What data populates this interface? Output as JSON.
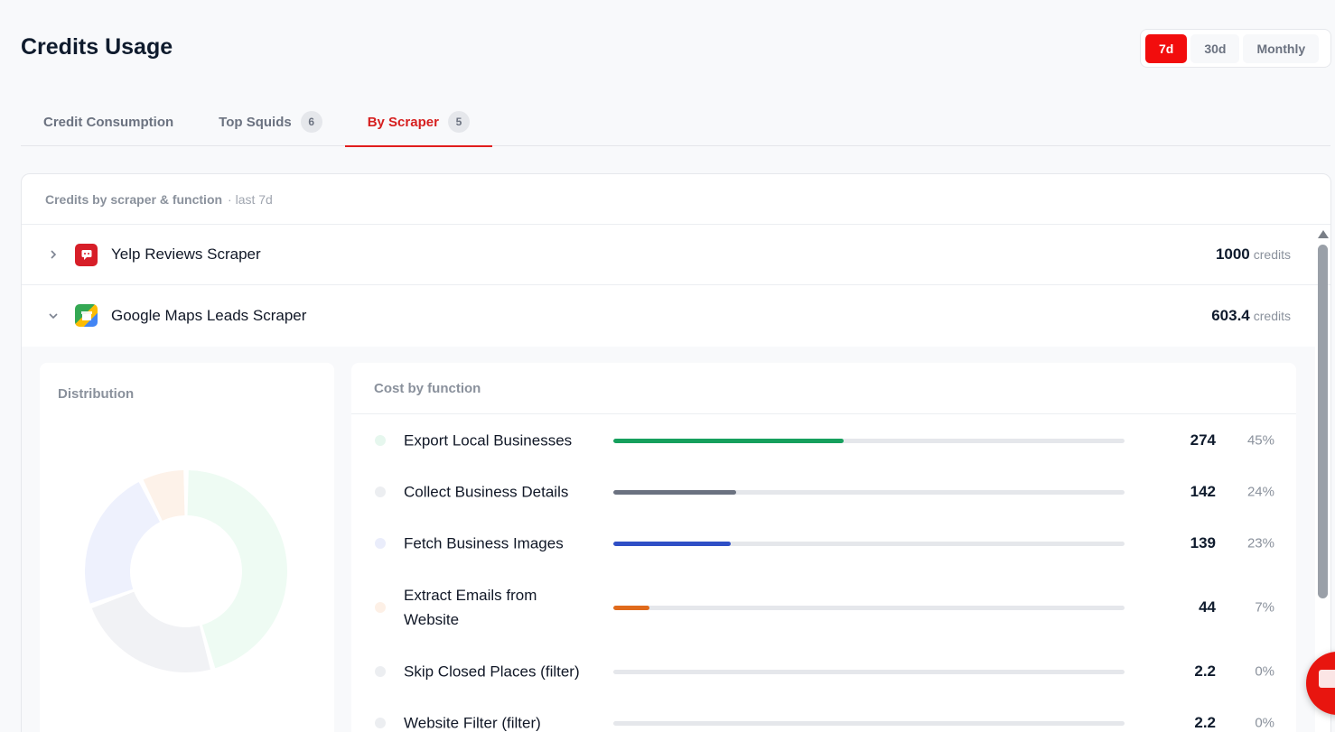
{
  "header": {
    "title": "Credits Usage"
  },
  "range": {
    "options": [
      "7d",
      "30d",
      "Monthly"
    ],
    "selected": "7d"
  },
  "tabs": [
    {
      "label": "Credit Consumption",
      "count": null
    },
    {
      "label": "Top Squids",
      "count": "6"
    },
    {
      "label": "By Scraper",
      "count": "5",
      "active": true
    }
  ],
  "card": {
    "title": "Credits by scraper & function",
    "subtitle": "· last 7d",
    "credits_unit": "credits",
    "scrapers": [
      {
        "name": "Yelp Reviews Scraper",
        "credits": "1000",
        "expanded": false,
        "icon": "yelp-icon"
      },
      {
        "name": "Google Maps Leads Scraper",
        "credits": "603.4",
        "expanded": true,
        "icon": "google-maps-icon"
      }
    ]
  },
  "distribution": {
    "title": "Distribution"
  },
  "cost_by_function": {
    "title": "Cost by function",
    "rows": [
      {
        "name": "Export Local Businesses",
        "value": "274",
        "pct": "45%",
        "fraction": 0.45,
        "color": "#16a05d",
        "dot": "#e6f7ee"
      },
      {
        "name": "Collect Business Details",
        "value": "142",
        "pct": "24%",
        "fraction": 0.24,
        "color": "#6b7280",
        "dot": "#eceef1"
      },
      {
        "name": "Fetch Business Images",
        "value": "139",
        "pct": "23%",
        "fraction": 0.23,
        "color": "#2f4fc6",
        "dot": "#eaedfb"
      },
      {
        "name": "Extract Emails from Website",
        "value": "44",
        "pct": "7%",
        "fraction": 0.07,
        "color": "#e06a1b",
        "dot": "#fdf0e6"
      },
      {
        "name": "Skip Closed Places (filter)",
        "value": "2.2",
        "pct": "0%",
        "fraction": 0.0,
        "color": "#9aa0a8",
        "dot": "#eceef1"
      },
      {
        "name": "Website Filter (filter)",
        "value": "2.2",
        "pct": "0%",
        "fraction": 0.0,
        "color": "#9aa0a8",
        "dot": "#eceef1"
      }
    ]
  },
  "chart_data": {
    "type": "pie",
    "categories": [
      "Export Local Businesses",
      "Collect Business Details",
      "Fetch Business Images",
      "Extract Emails from Website"
    ],
    "values": [
      274,
      142,
      139,
      44
    ],
    "colors": [
      "#eefbf3",
      "#f1f2f5",
      "#eef1fd",
      "#fdf2e9"
    ]
  },
  "colors": {
    "accent": "#f20d0d",
    "tab_active": "#d61f1f"
  }
}
